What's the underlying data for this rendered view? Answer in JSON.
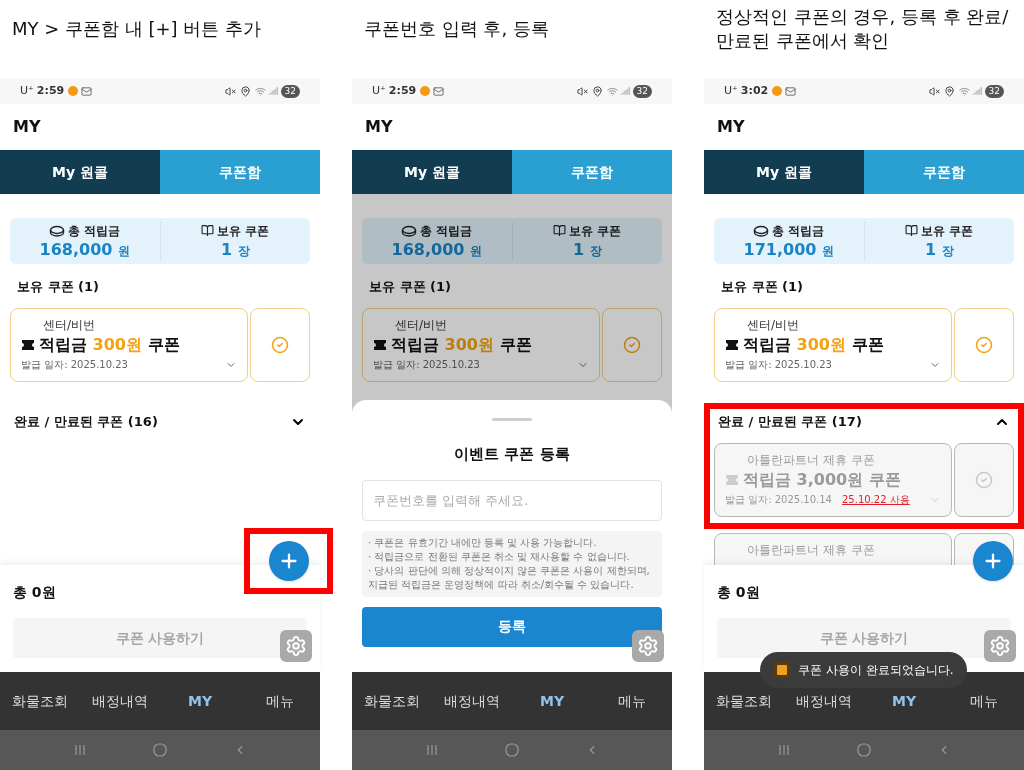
{
  "panels": [
    {
      "caption": "MY > 쿠폰함 내 [+] 버튼 추가",
      "status": {
        "carrier": "U⁺",
        "time": "2:59",
        "battery": "32"
      },
      "title": "MY",
      "tabs": [
        {
          "label": "My 원콜",
          "selected": false
        },
        {
          "label": "쿠폰함",
          "selected": true
        }
      ],
      "summary": [
        {
          "kind": "points",
          "label": "총 적립금",
          "value": "168,000",
          "unit": "원"
        },
        {
          "kind": "coupons",
          "label": "보유 쿠폰",
          "value": "1",
          "unit": "장"
        }
      ],
      "held_title": "보유 쿠폰 (1)",
      "held": [
        {
          "issuer": "센터/비번",
          "prefix": "적립금",
          "amount": "300원",
          "suffix": "쿠폰",
          "date": "발급 일자: 2025.10.23",
          "disabled": false
        }
      ],
      "expired": {
        "title": "완료 / 만료된 쿠폰 (16)",
        "expanded": false,
        "highlighted": false
      },
      "fab": {
        "highlighted": true
      },
      "footer": {
        "total": "총 0원",
        "button": "쿠폰 사용하기",
        "disabled": true
      },
      "nav": [
        {
          "label": "화물조회",
          "selected": false
        },
        {
          "label": "배정내역",
          "selected": false
        },
        {
          "label": "MY",
          "selected": true
        },
        {
          "label": "메뉴",
          "selected": false
        }
      ]
    },
    {
      "caption": "쿠폰번호 입력 후, 등록",
      "status": {
        "carrier": "U⁺",
        "time": "2:59",
        "battery": "32"
      },
      "title": "MY",
      "tabs": [
        {
          "label": "My 원콜",
          "selected": false
        },
        {
          "label": "쿠폰함",
          "selected": true
        }
      ],
      "summary": [
        {
          "kind": "points",
          "label": "총 적립금",
          "value": "168,000",
          "unit": "원"
        },
        {
          "kind": "coupons",
          "label": "보유 쿠폰",
          "value": "1",
          "unit": "장"
        }
      ],
      "held_title": "보유 쿠폰 (1)",
      "held": [
        {
          "issuer": "센터/비번",
          "prefix": "적립금",
          "amount": "300원",
          "suffix": "쿠폰",
          "date": "발급 일자: 2025.10.23",
          "disabled": false
        }
      ],
      "sheet": {
        "title": "이벤트 쿠폰 등록",
        "placeholder": "쿠폰번호를 입력해 주세요.",
        "notes": [
          "· 쿠폰은 유효기간 내에만 등록 및 사용 가능합니다.",
          "· 적립금으로 전환된 쿠폰은 취소 및 재사용할 수 없습니다.",
          "· 당사의 판단에 의해 정상적이지 않은 쿠폰은 사용이 제한되며, 지급된 적립금은 운영정책에 따라 취소/회수될 수 있습니다."
        ],
        "button": "등록"
      },
      "nav": [
        {
          "label": "화물조회",
          "selected": false
        },
        {
          "label": "배정내역",
          "selected": false
        },
        {
          "label": "MY",
          "selected": true
        },
        {
          "label": "메뉴",
          "selected": false
        }
      ]
    },
    {
      "caption": "정상적인 쿠폰의 경우, 등록 후 완료/ 만료된 쿠폰에서 확인",
      "status": {
        "carrier": "U⁺",
        "time": "3:02",
        "battery": "32"
      },
      "title": "MY",
      "tabs": [
        {
          "label": "My 원콜",
          "selected": false
        },
        {
          "label": "쿠폰함",
          "selected": true
        }
      ],
      "summary": [
        {
          "kind": "points",
          "label": "총 적립금",
          "value": "171,000",
          "unit": "원"
        },
        {
          "kind": "coupons",
          "label": "보유 쿠폰",
          "value": "1",
          "unit": "장"
        }
      ],
      "held_title": "보유 쿠폰 (1)",
      "held": [
        {
          "issuer": "센터/비번",
          "prefix": "적립금",
          "amount": "300원",
          "suffix": "쿠폰",
          "date": "발급 일자: 2025.10.23",
          "disabled": false
        }
      ],
      "expired": {
        "title": "완료 / 만료된 쿠폰 (17)",
        "expanded": true,
        "highlighted": true,
        "items": [
          {
            "issuer": "아틀란파트너 제휴 쿠폰",
            "prefix": "적립금",
            "amount": "3,000원",
            "suffix": "쿠폰",
            "date": "발급 일자: 2025.10.14",
            "used": "25.10.22 사용",
            "disabled": true
          },
          {
            "issuer": "아틀란파트너 제휴 쿠폰",
            "disabled": true
          }
        ]
      },
      "fab": {
        "highlighted": false
      },
      "footer": {
        "total": "총 0원",
        "button": "쿠폰 사용하기",
        "disabled": true
      },
      "toast": {
        "text": "쿠폰 사용이 완료되었습니다."
      },
      "nav": [
        {
          "label": "화물조회",
          "selected": false
        },
        {
          "label": "배정내역",
          "selected": false
        },
        {
          "label": "MY",
          "selected": true
        },
        {
          "label": "메뉴",
          "selected": false
        }
      ]
    }
  ]
}
